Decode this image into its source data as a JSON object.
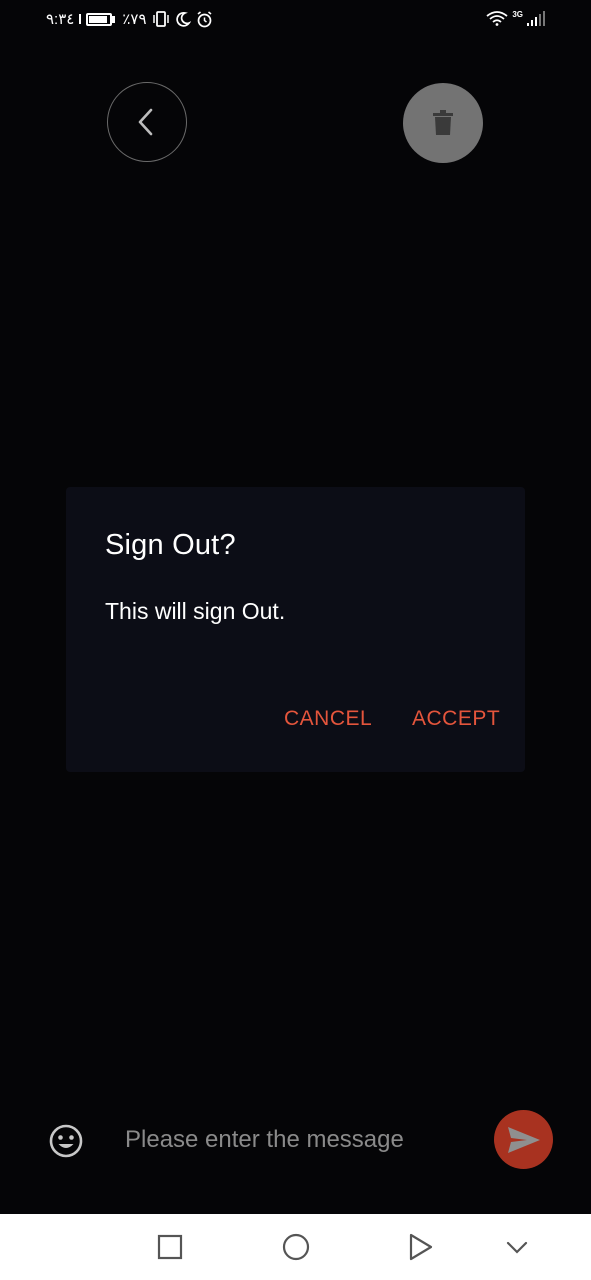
{
  "status_bar": {
    "time": "٩:٣٤",
    "battery": "٪٧٩",
    "network_type": "3G",
    "icons": [
      "battery-icon",
      "vibrate-icon",
      "moon-icon",
      "alarm-icon",
      "wifi-icon",
      "signal-icon"
    ]
  },
  "header": {
    "back_icon": "chevron-left-icon",
    "delete_icon": "trash-icon"
  },
  "dialog": {
    "title": "Sign Out?",
    "message": "This will sign Out.",
    "cancel_label": "CANCEL",
    "accept_label": "ACCEPT"
  },
  "composer": {
    "emoji_icon": "smiley-icon",
    "placeholder": "Please enter the message",
    "value": "",
    "send_icon": "send-icon"
  },
  "nav_bar": {
    "icons": [
      "square-recents-icon",
      "circle-home-icon",
      "triangle-back-icon",
      "chevron-down-icon"
    ]
  },
  "colors": {
    "background": "#050507",
    "dialog_bg": "#0c0d16",
    "accent": "#e4553c",
    "send_bg": "#a83220",
    "trash_bg": "#737373"
  }
}
